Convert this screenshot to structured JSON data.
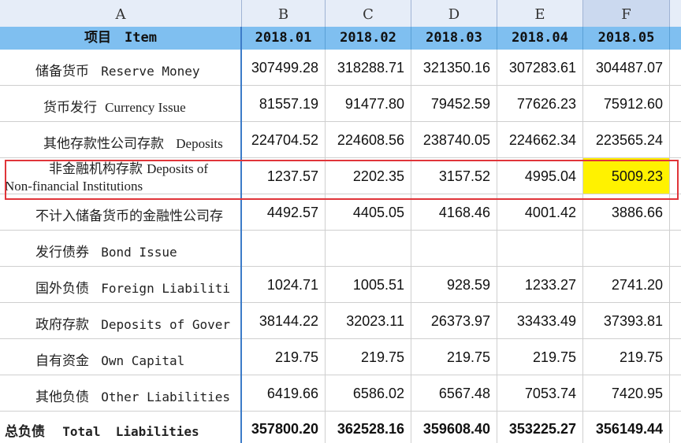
{
  "columns": [
    "A",
    "B",
    "C",
    "D",
    "E",
    "F"
  ],
  "header": {
    "item_label": "项目　Item",
    "periods": [
      "2018.01",
      "2018.02",
      "2018.03",
      "2018.04",
      "2018.05"
    ]
  },
  "rows": [
    {
      "cn": "储备货币",
      "en": "Reserve Money",
      "values": [
        "307499.28",
        "318288.71",
        "321350.16",
        "307283.61",
        "304487.07"
      ]
    },
    {
      "cn": "货币发行",
      "en": "Currency Issue",
      "values": [
        "81557.19",
        "91477.80",
        "79452.59",
        "77626.23",
        "75912.60"
      ]
    },
    {
      "cn": "其他存款性公司存款",
      "en": "Deposits",
      "values": [
        "224704.52",
        "224608.56",
        "238740.05",
        "224662.34",
        "223565.24"
      ]
    },
    {
      "cn": "非金融机构存款",
      "en": "Deposits of",
      "en2": "Non-financial Institutions",
      "values": [
        "1237.57",
        "2202.35",
        "3157.52",
        "4995.04",
        "5009.23"
      ]
    },
    {
      "cn": "不计入储备货币的金融性公司存",
      "en": "",
      "values": [
        "4492.57",
        "4405.05",
        "4168.46",
        "4001.42",
        "3886.66"
      ]
    },
    {
      "cn": "发行债券",
      "en": "Bond Issue",
      "values": [
        "",
        "",
        "",
        "",
        ""
      ]
    },
    {
      "cn": "国外负债",
      "en": "Foreign Liabiliti",
      "values": [
        "1024.71",
        "1005.51",
        "928.59",
        "1233.27",
        "2741.20"
      ]
    },
    {
      "cn": "政府存款",
      "en": "Deposits of Gover",
      "values": [
        "38144.22",
        "32023.11",
        "26373.97",
        "33433.49",
        "37393.81"
      ]
    },
    {
      "cn": "自有资金",
      "en": "Own Capital",
      "values": [
        "219.75",
        "219.75",
        "219.75",
        "219.75",
        "219.75"
      ]
    },
    {
      "cn": "其他负债",
      "en": "Other Liabilities",
      "values": [
        "6419.66",
        "6586.02",
        "6567.48",
        "7053.74",
        "7420.95"
      ]
    },
    {
      "cn": "总负债",
      "en": "Total  Liabilities",
      "values": [
        "357800.20",
        "362528.16",
        "359608.40",
        "353225.27",
        "356149.44"
      ]
    }
  ],
  "highlight_color": "#fff200",
  "box_color": "#e0353a"
}
